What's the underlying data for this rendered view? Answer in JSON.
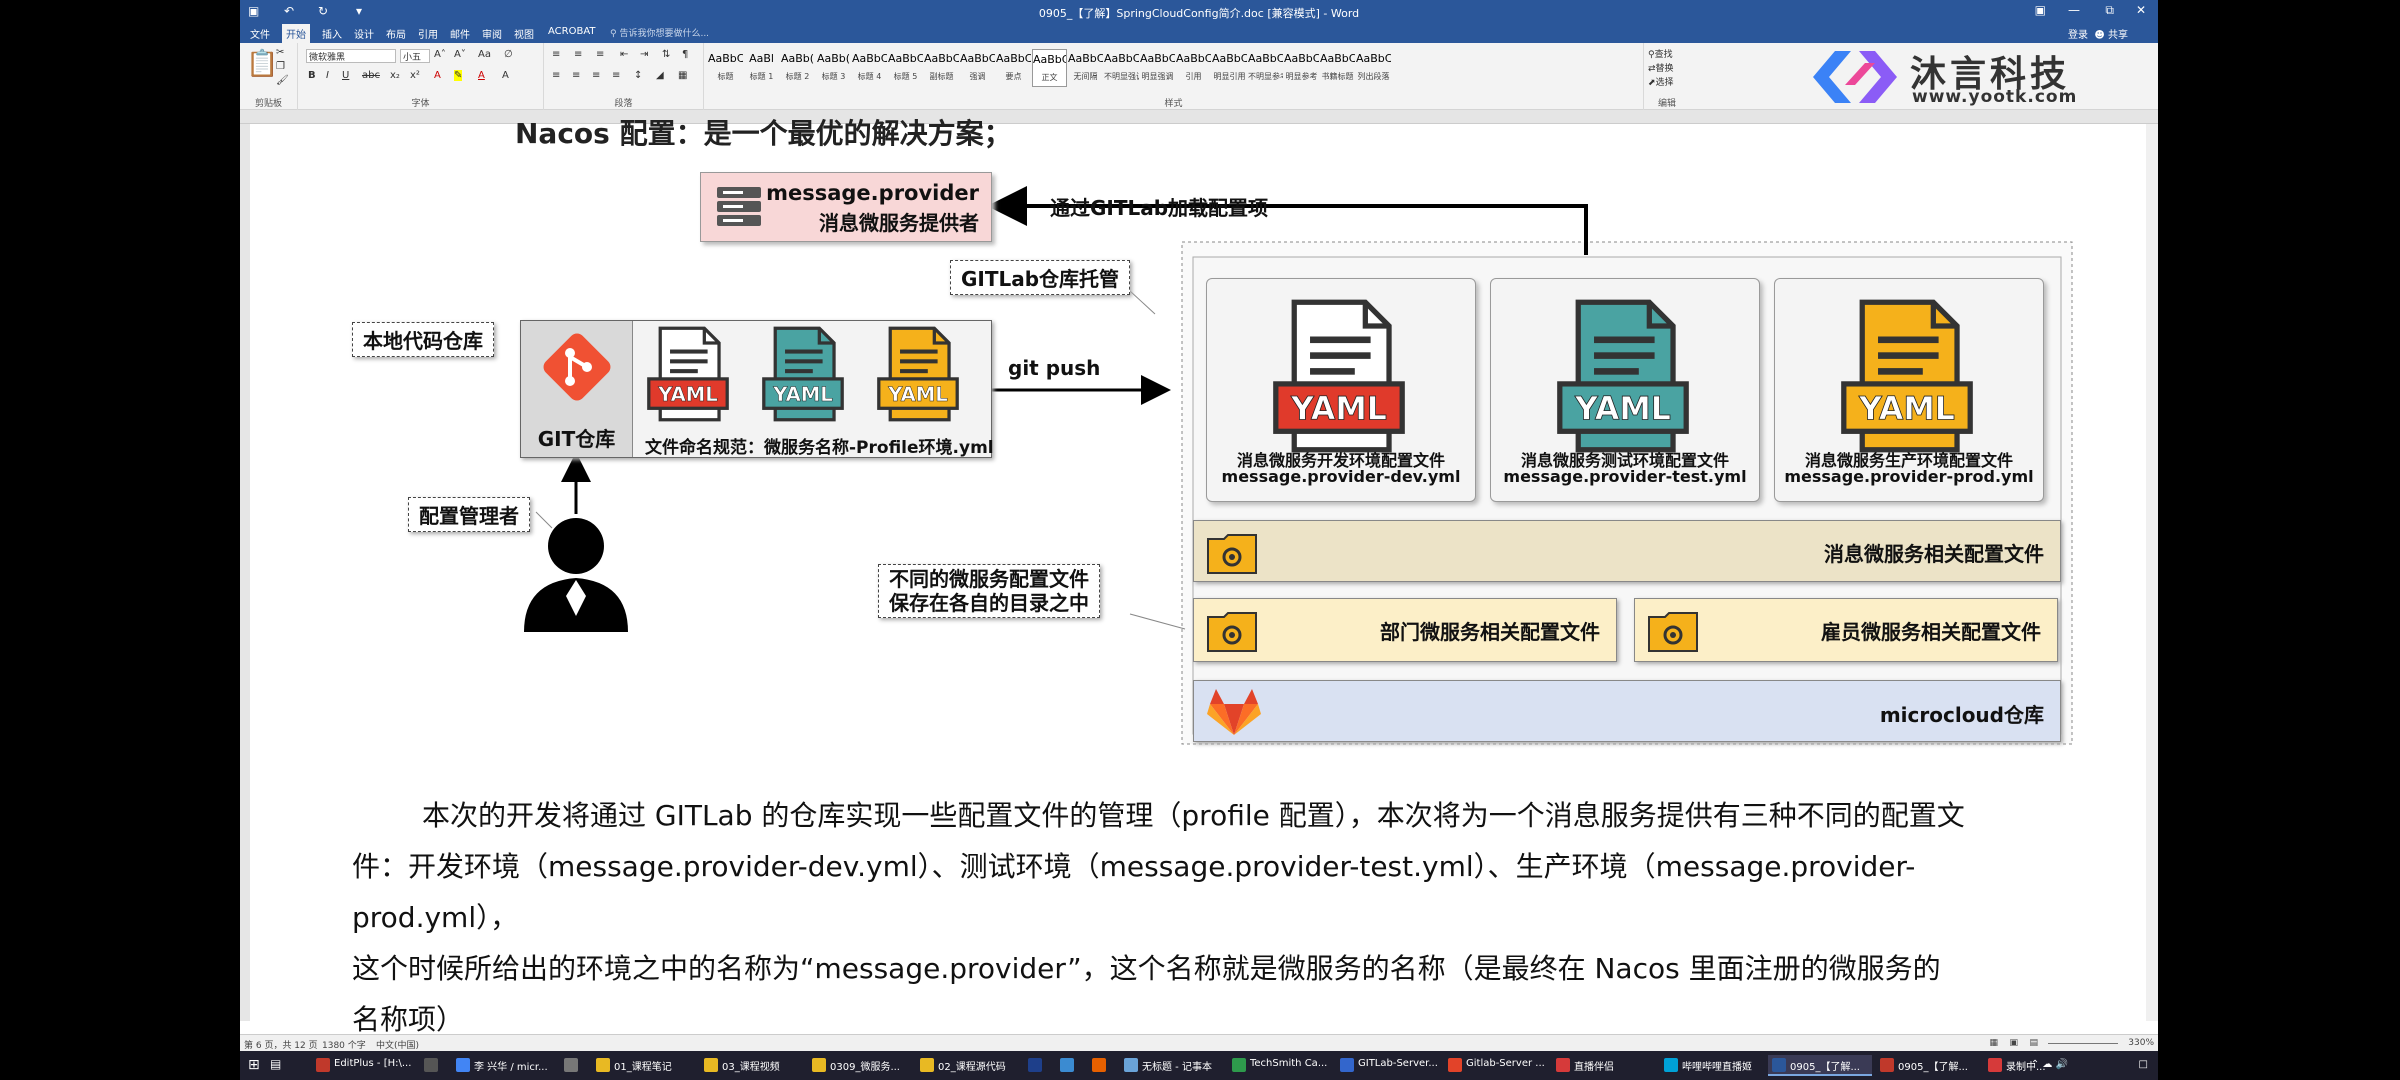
{
  "window": {
    "title": "0905_【了解】SpringCloudConfig简介.doc [兼容模式] - Word",
    "quick_access": [
      "save-icon",
      "undo-icon",
      "redo-icon",
      "customize-icon"
    ]
  },
  "menu": {
    "tabs": [
      "文件",
      "开始",
      "插入",
      "设计",
      "布局",
      "引用",
      "邮件",
      "审阅",
      "视图",
      "ACROBAT"
    ],
    "active": "开始",
    "tell_me": "告诉我你想要做什么...",
    "login": "登录",
    "share": "共享"
  },
  "ribbon": {
    "groups": [
      "剪贴板",
      "字体",
      "段落",
      "样式",
      "编辑"
    ],
    "font_name": "微软雅黑",
    "font_size": "小五",
    "styles": [
      {
        "preview": "AaBbC",
        "name": "标题"
      },
      {
        "preview": "AaBl",
        "name": "标题 1"
      },
      {
        "preview": "AaBb(",
        "name": "标题 2"
      },
      {
        "preview": "AaBb(",
        "name": "标题 3"
      },
      {
        "preview": "AaBbC(",
        "name": "标题 4"
      },
      {
        "preview": "AaBbC",
        "name": "标题 5"
      },
      {
        "preview": "AaBbC",
        "name": "副标题"
      },
      {
        "preview": "AaBbCcDc",
        "name": "强调"
      },
      {
        "preview": "AaBbCcD",
        "name": "要点"
      },
      {
        "preview": "AaBbCcDc",
        "name": "正文"
      },
      {
        "preview": "AaBbCcDc",
        "name": "无间隔"
      },
      {
        "preview": "AaBbCcDc",
        "name": "不明显强调"
      },
      {
        "preview": "AaBbCcDc",
        "name": "明显强调"
      },
      {
        "preview": "AaBbCcDc",
        "name": "引用"
      },
      {
        "preview": "AaBbCcDc",
        "name": "明显引用"
      },
      {
        "preview": "AaBbCcD",
        "name": "不明显参考"
      },
      {
        "preview": "AaBbCcI",
        "name": "明显参考"
      },
      {
        "preview": "AaBbCcD",
        "name": "书籍标题"
      },
      {
        "preview": "AaBbCcDc",
        "name": "列出段落"
      }
    ],
    "selected_style": "正文",
    "edit_items": [
      "查找",
      "替换",
      "选择"
    ]
  },
  "brand": {
    "name": "沐言科技",
    "url": "www.yootk.com"
  },
  "diagram": {
    "top_heading": "Nacos 配置：是一个最优的解决方案；",
    "provider_line1": "message.provider",
    "provider_line2": "消息微服务提供者",
    "load_label": "通过GITLab加载配置项",
    "gitlab_host_label": "GITLab仓库托管",
    "local_repo_label": "本地代码仓库",
    "git_repo_label": "GIT仓库",
    "git_push_label": "git push",
    "naming_rule": "文件命名规范：微服务名称-Profile环境.yml",
    "manager_label": "配置管理者",
    "yaml_badge": "YAML",
    "cards": [
      {
        "line1": "消息微服务开发环境配置文件",
        "line2": "message.provider-dev.yml",
        "color": "#e03a2b"
      },
      {
        "line1": "消息微服务测试环境配置文件",
        "line2": "message.provider-test.yml",
        "color": "#4aa3a2"
      },
      {
        "line1": "消息微服务生产环境配置文件",
        "line2": "message.provider-prod.yml",
        "color": "#f5b11b"
      }
    ],
    "message_folder": "消息微服务相关配置文件",
    "dir_note_line1": "不同的微服务配置文件",
    "dir_note_line2": "保存在各自的目录之中",
    "dept_folder": "部门微服务相关配置文件",
    "emp_folder": "雇员微服务相关配置文件",
    "microcloud_repo": "microcloud仓库"
  },
  "body": {
    "para1": "本次的开发将通过 GITLab 的仓库实现一些配置文件的管理（profile 配置），本次将为一个消息服务提供有三种不同的配置文",
    "para2": "件：开发环境（message.provider-dev.yml）、测试环境（message.provider-test.yml）、生产环境（message.provider-prod.yml），",
    "para3": "这个时候所给出的环境之中的名称为“message.provider”，这个名称就是微服务的名称（是最终在 Nacos 里面注册的微服务的",
    "para4": "名称项）"
  },
  "status": {
    "page": "第 6 页，共 12 页",
    "words": "1380 个字",
    "lang": "中文(中国)",
    "zoom": "330%"
  },
  "taskbar": {
    "items": [
      {
        "label": "EditPlus - [H:\\...",
        "color": "#c0392b"
      },
      {
        "label": "",
        "color": "#555"
      },
      {
        "label": "李 兴华 / micr...",
        "color": "#4285f4"
      },
      {
        "label": "",
        "color": "#777"
      },
      {
        "label": "01_课程笔记",
        "color": "#e8b923"
      },
      {
        "label": "03_课程视频",
        "color": "#e8b923"
      },
      {
        "label": "0309_微服务...",
        "color": "#e8b923"
      },
      {
        "label": "02_课程源代码",
        "color": "#e8b923"
      },
      {
        "label": "",
        "color": "#1e3f8a"
      },
      {
        "label": "",
        "color": "#3b8bd1"
      },
      {
        "label": "",
        "color": "#e66000"
      },
      {
        "label": "无标题 - 记事本",
        "color": "#6aa3d8"
      },
      {
        "label": "TechSmith Ca...",
        "color": "#2e9a4c"
      },
      {
        "label": "GITLab-Server...",
        "color": "#3366cc"
      },
      {
        "label": "Gitlab-Server ...",
        "color": "#e24329"
      },
      {
        "label": "直播伴侣",
        "color": "#d63a3a"
      },
      {
        "label": "哔哩哔哩直播姬",
        "color": "#00a1d6"
      },
      {
        "label": "0905_【了解...",
        "color": "#2b579a"
      },
      {
        "label": "0905_【了解...",
        "color": "#c0392b"
      },
      {
        "label": "录制中...",
        "color": "#d63a3a"
      }
    ],
    "active_index": 17
  }
}
